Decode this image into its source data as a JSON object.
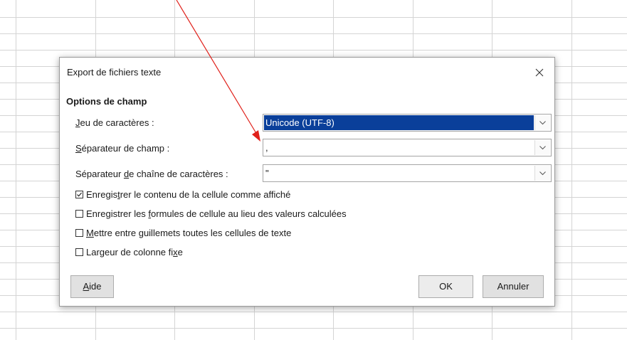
{
  "dialog": {
    "title": "Export de fichiers texte",
    "close_glyph": "×",
    "section_title": "Options de champ",
    "fields": {
      "charset": {
        "label_pre": "",
        "label_key": "J",
        "label_post": "eu de caractères :",
        "value": "Unicode (UTF-8)"
      },
      "field_sep": {
        "label_pre": "",
        "label_key": "S",
        "label_post": "éparateur de champ :",
        "value": ","
      },
      "string_sep": {
        "label_pre": "Séparateur ",
        "label_key": "d",
        "label_post": "e chaîne de caractères :",
        "value": "\""
      }
    },
    "checkboxes": [
      {
        "pre": "Enregis",
        "key": "t",
        "post": "rer le contenu de la cellule comme affiché",
        "checked": true
      },
      {
        "pre": "Enregistrer les ",
        "key": "f",
        "post": "ormules de cellule au lieu des valeurs calculées",
        "checked": false
      },
      {
        "pre": "",
        "key": "M",
        "post": "ettre entre guillemets toutes les cellules de texte",
        "checked": false
      },
      {
        "pre": "Largeur de colonne fi",
        "key": "x",
        "post": "e",
        "checked": false
      }
    ],
    "buttons": {
      "help_key": "A",
      "help_rest": "ide",
      "ok": "OK",
      "cancel": "Annuler"
    }
  },
  "colors": {
    "selection": "#0a3f9a",
    "annotation_arrow": "#e0201a",
    "grid_line": "#d4d4d4"
  }
}
